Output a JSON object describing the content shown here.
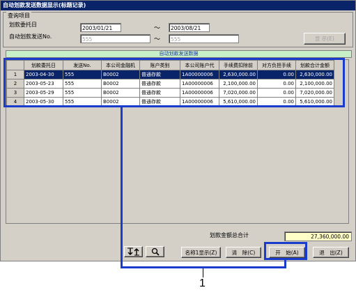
{
  "window": {
    "title": "自动划款发送数据显示(标题记录)"
  },
  "query": {
    "group_label": "查询项目",
    "date_label": "划款委托日",
    "date_from": "2003/01/21",
    "range_sep": "～",
    "date_to": "2003/08/21",
    "no_label": "自动划款发送No.",
    "no_from": "555",
    "no_to": "555",
    "display_button": "显 示(E)"
  },
  "banner": "自动划款发送数据",
  "table": {
    "columns": [
      "划款委托日",
      "发送No.",
      "本公司金融机",
      "账户类别",
      "本公司账户代",
      "手续费扣除前",
      "对方负担手续",
      "划款合计金额"
    ],
    "rows": [
      {
        "rn": "1",
        "cells": [
          "2003-04-30",
          "555",
          "B0002",
          "普通存款",
          "1A00000006",
          "2,630,000.00",
          "0.00",
          "2,630,000.00"
        ]
      },
      {
        "rn": "2",
        "cells": [
          "2003-05-23",
          "555",
          "B0002",
          "普通存款",
          "1A00000006",
          "2,100,000.00",
          "0.00",
          "2,100,000.00"
        ]
      },
      {
        "rn": "3",
        "cells": [
          "2003-05-29",
          "555",
          "B0002",
          "普通存款",
          "1A00000006",
          "7,020,000.00",
          "0.00",
          "7,020,000.00"
        ]
      },
      {
        "rn": "4",
        "cells": [
          "2003-05-30",
          "555",
          "B0002",
          "普通存款",
          "1A00000006",
          "5,610,000.00",
          "0.00",
          "5,610,000.00"
        ]
      }
    ]
  },
  "total": {
    "label": "划款金额总合计",
    "value": "27,360,000.00"
  },
  "buttons": {
    "sort_icon": "sort-icon",
    "search_icon": "search-icon",
    "name_display": "名称1显示(Z)",
    "clear": "清　除(C)",
    "start": "开　始(A)",
    "exit": "退　出(Z)"
  },
  "callout": {
    "label": "1"
  },
  "accent_colors": {
    "title_bar": "#0a246a",
    "annotation": "#1a3ccd",
    "banner_bg": "#c8f0c8",
    "total_bg": "#ffffc8"
  }
}
